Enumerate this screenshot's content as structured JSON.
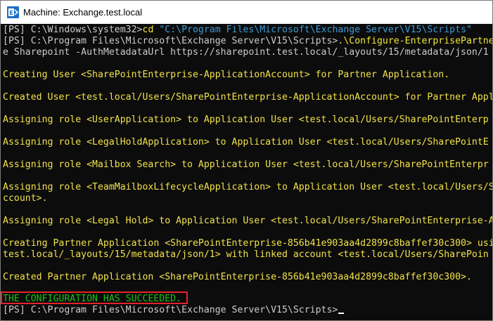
{
  "window": {
    "title": "Machine: Exchange.test.local",
    "app_icon": "exchange-powershell-icon"
  },
  "colors": {
    "console_bg": "#0c0c0c",
    "output_text": "#f2e24a",
    "success_text": "#16c60c",
    "string_literal": "#3b9bd6",
    "command": "#f0e63c",
    "highlight_border": "#e5242a"
  },
  "console": {
    "cmd1_prompt": "[PS] C:\\Windows\\system32>",
    "cmd1_verb": "cd",
    "cmd1_arg": " \"C:\\Program Files\\Microsoft\\Exchange Server\\V15\\Scripts\"",
    "cmd2_prompt": "[PS] C:\\Program Files\\Microsoft\\Exchange Server\\V15\\Scripts>",
    "cmd2_verb": ".\\Configure-EnterprisePartne",
    "cmd2_wrap": "e Sharepoint -AuthMetadataUrl https://sharepoint.test.local/_layouts/15/metadata/json/1",
    "out_creating_user": "Creating User <SharePointEnterprise-ApplicationAccount> for Partner Application.",
    "out_created_user": "Created User <test.local/Users/SharePointEnterprise-ApplicationAccount> for Partner Appl",
    "out_role_userapp": "Assigning role <UserApplication> to Application User <test.local/Users/SharePointEnterp",
    "out_role_legalholdapp": "Assigning role <LegalHoldApplication> to Application User <test.local/Users/SharePointE",
    "out_role_mailboxsearch": "Assigning role <Mailbox Search> to Application User <test.local/Users/SharePointEnterpr",
    "out_role_teammailbox": "Assigning role <TeamMailboxLifecycleApplication> to Application User <test.local/Users/S",
    "out_role_teammailbox_wrap": "ccount>.",
    "out_role_legalhold": "Assigning role <Legal Hold> to Application User <test.local/Users/SharePointEnterprise-A",
    "out_creating_partner": "Creating Partner Application <SharePointEnterprise-856b41e903aa4d2899c8baffef30c300> usi",
    "out_creating_partner_wrap": "test.local/_layouts/15/metadata/json/1> with linked account <test.local/Users/SharePoin",
    "out_created_partner": "Created Partner Application <SharePointEnterprise-856b41e903aa4d2899c8baffef30c300>.",
    "out_success": "THE CONFIGURATION HAS SUCCEEDED.",
    "final_prompt": "[PS] C:\\Program Files\\Microsoft\\Exchange Server\\V15\\Scripts>"
  }
}
